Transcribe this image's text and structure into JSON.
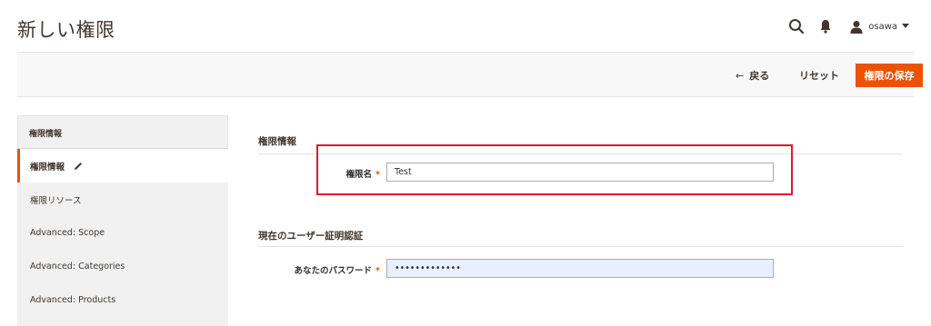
{
  "header": {
    "title": "新しい権限",
    "user_name": "osawa",
    "search_icon": "search-icon",
    "bell_icon": "notification-bell-icon",
    "user_icon": "user-icon"
  },
  "action_bar": {
    "back_arrow": "←",
    "back_label": "戻る",
    "reset_label": "リセット",
    "save_label": "権限の保存",
    "save_color": "#eb5202"
  },
  "sidebar": {
    "heading": "権限情報",
    "items": [
      {
        "label": "権限情報",
        "active": true
      },
      {
        "label": "権限リソース",
        "active": false
      },
      {
        "label": "Advanced: Scope",
        "active": false
      },
      {
        "label": "Advanced: Categories",
        "active": false
      },
      {
        "label": "Advanced: Products",
        "active": false
      }
    ]
  },
  "form": {
    "section1_title": "権限情報",
    "role_name_label": "権限名",
    "role_name_value": "Test",
    "section2_title": "現在のユーザー証明認証",
    "password_label": "あなたのパスワード",
    "password_value": "•••••••••••••",
    "required_mark": "*"
  },
  "colors": {
    "accent": "#eb5202",
    "highlight": "#e0182d"
  }
}
